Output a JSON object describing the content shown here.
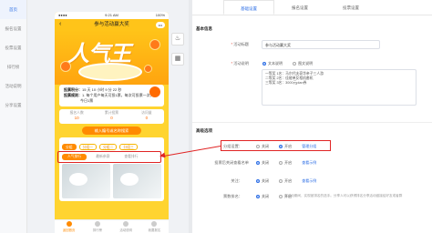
{
  "sidebar": {
    "items": [
      {
        "label": "首页",
        "active": true
      },
      {
        "label": "报名设置"
      },
      {
        "label": "投票设置"
      },
      {
        "label": "排行榜"
      },
      {
        "label": "活动说明"
      },
      {
        "label": "分享设置"
      }
    ]
  },
  "phone": {
    "status_left": "●●●●",
    "status_time": "9:21 AM",
    "status_right": "100%",
    "nav_title": "参与活动赢大奖",
    "nav_back": "‹",
    "nav_more": "•••",
    "banner_text": "人气王",
    "info_rows": [
      {
        "k": "投票积分：",
        "v": "15 天 10 小时 9 分 22 秒"
      },
      {
        "k": "投票规则：",
        "v": "1. 每个用户每天可投1票，每次可投票一次，"
      },
      {
        "k": "",
        "v": "今日1票"
      }
    ],
    "stats": [
      {
        "label": "报名人数",
        "value": "10"
      },
      {
        "label": "累计投票",
        "value": "0"
      },
      {
        "label": "访问量",
        "value": "0"
      }
    ],
    "cta": "输入编号或名称搜索",
    "chips": [
      "分组",
      "分组一",
      "分组二",
      "分组三"
    ],
    "subtabs": [
      "人气排行",
      "最新参赛",
      "查看排行"
    ],
    "tabbar": [
      "返回首页",
      "排行榜",
      "活动说明",
      "我要报名"
    ]
  },
  "side_icons": [
    "pot-icon",
    "grid-icon"
  ],
  "panel": {
    "tabs": [
      "基础设置",
      "报名设置",
      "投票设置"
    ],
    "section_basic": "基本信息",
    "activity_title_label": "活动标题",
    "activity_title_value": "参与活动赢大奖",
    "activity_desc_label": "活动说明",
    "desc_mode_text": "文本说明",
    "desc_mode_image": "图文说明",
    "desc_lines": [
      "一等奖 1名：马尔代夫豪华亲子三人游",
      "二等奖 2名：佳能单反相机套机",
      "三等奖 3名：3000元plan券"
    ],
    "section_advanced": "高级选项",
    "group_label": "分组设置：",
    "off": "关闭",
    "on": "开启",
    "group_link": "管理分组",
    "vote_once_label": "投票后关闭查看名单",
    "vote_once_link": "查看示例",
    "share_label": "关注：",
    "share_link": "查看示例",
    "rank_label": "票数排名：",
    "rank_hint": "在活动期间，实现被排名的选手。分享人可以获得排名分享活动链接给好友或者群"
  },
  "colors": {
    "accent": "#2b6de5",
    "annotation": "#e02424",
    "phone_bg": "#ffd430",
    "orange": "#ff8a00"
  }
}
